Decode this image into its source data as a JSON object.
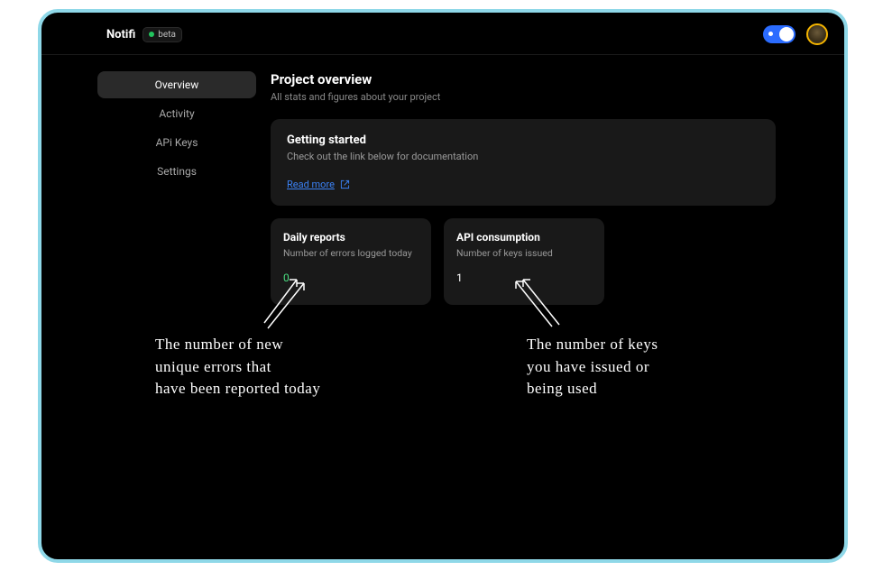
{
  "brand": {
    "name": "Notifi",
    "badge": "beta"
  },
  "toggle": {
    "on": true
  },
  "sidebar": {
    "items": [
      {
        "label": "Overview",
        "active": true
      },
      {
        "label": "Activity",
        "active": false
      },
      {
        "label": "APi Keys",
        "active": false
      },
      {
        "label": "Settings",
        "active": false
      }
    ]
  },
  "page": {
    "title": "Project overview",
    "subtitle": "All stats and figures about your project"
  },
  "getting_started": {
    "title": "Getting started",
    "subtitle": "Check out the link below for documentation",
    "cta": "Read more"
  },
  "stats": [
    {
      "title": "Daily reports",
      "subtitle": "Number of errors logged today",
      "value": "0",
      "green": true
    },
    {
      "title": "API consumption",
      "subtitle": "Number of keys issued",
      "value": "1",
      "green": false
    }
  ],
  "annotations": [
    {
      "text": "The number of new\nunique errors that\nhave been reported today"
    },
    {
      "text": "The number of keys\nyou have issued or\nbeing used"
    }
  ],
  "colors": {
    "frame_border": "#8fd8e8",
    "accent_blue": "#3b82f6",
    "toggle_blue": "#2b6cff",
    "card_bg": "#191919",
    "green": "#4ade80",
    "avatar_ring": "#f4b400"
  }
}
